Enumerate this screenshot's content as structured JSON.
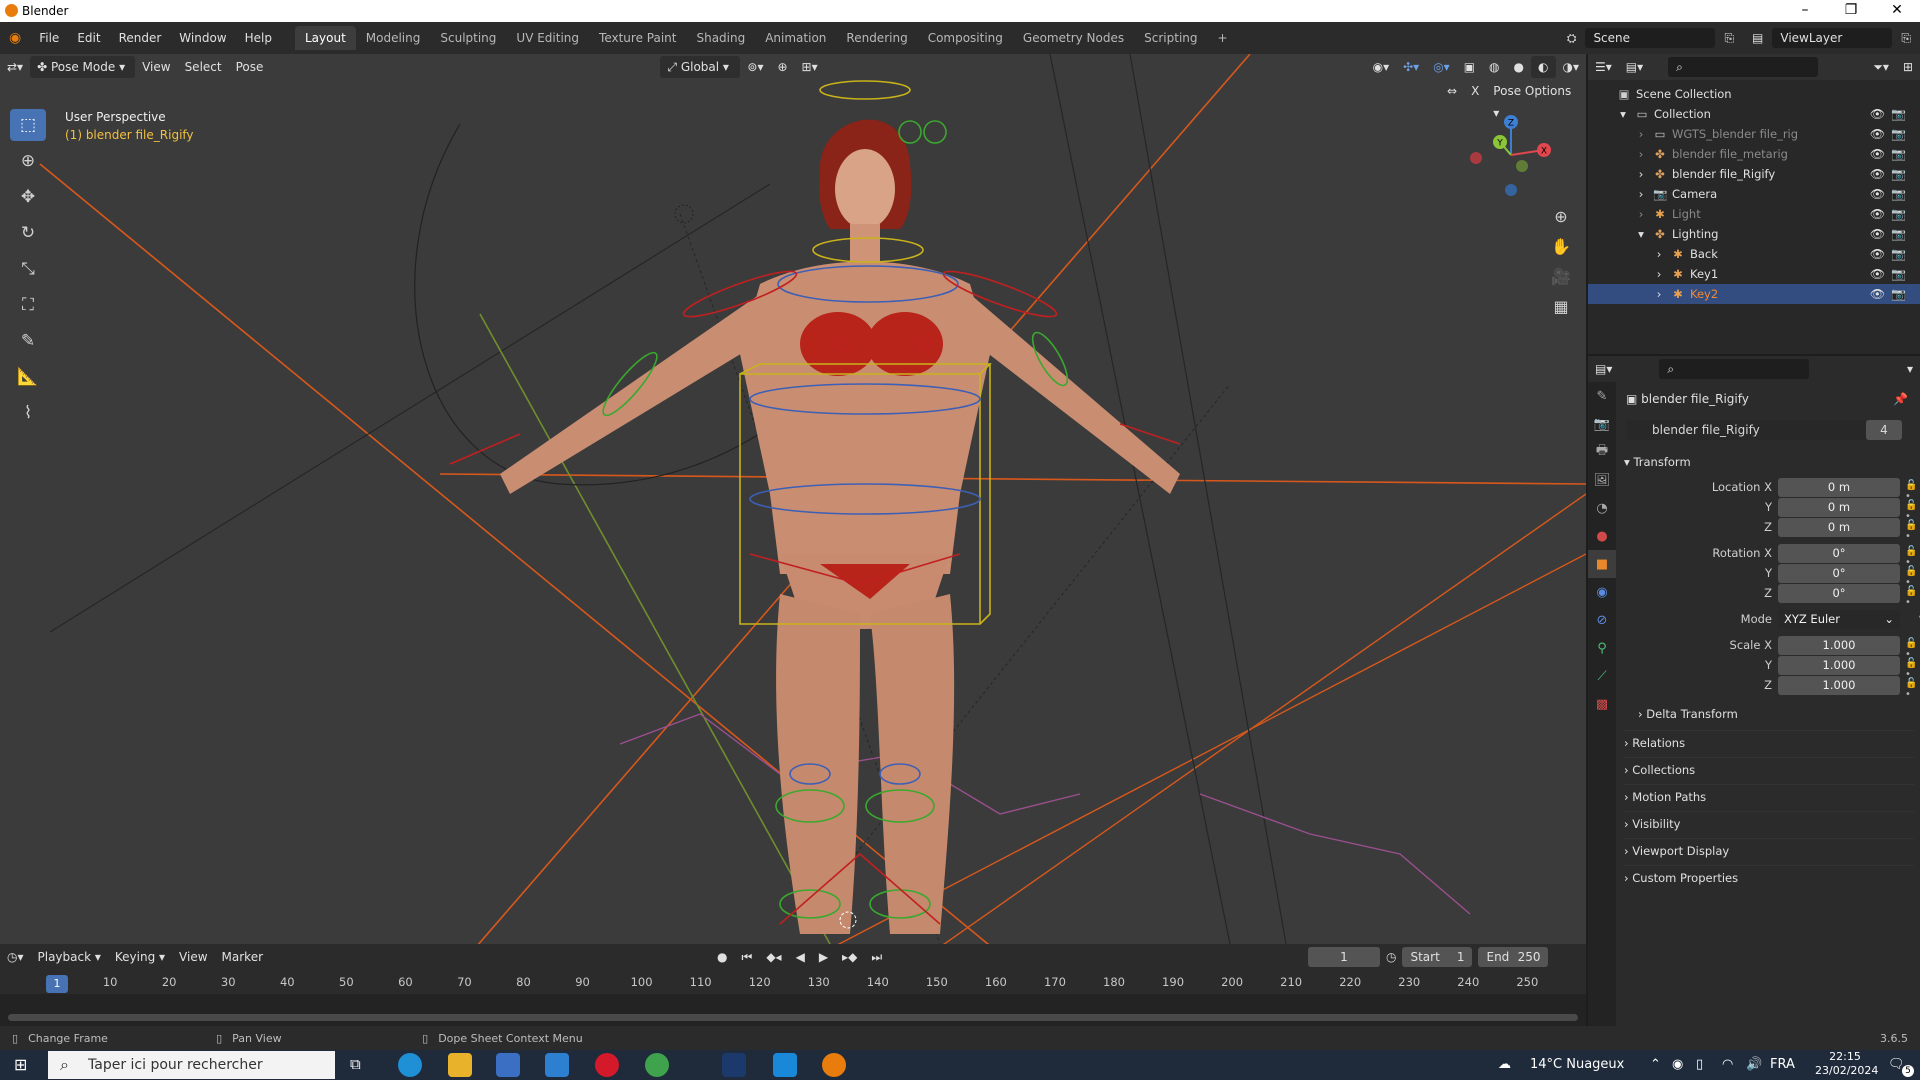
{
  "window": {
    "title": "Blender",
    "controls": [
      "–",
      "❐",
      "✕"
    ]
  },
  "menubar": {
    "menus": [
      "File",
      "Edit",
      "Render",
      "Window",
      "Help"
    ],
    "workspaces": [
      "Layout",
      "Modeling",
      "Sculpting",
      "UV Editing",
      "Texture Paint",
      "Shading",
      "Animation",
      "Rendering",
      "Compositing",
      "Geometry Nodes",
      "Scripting"
    ],
    "active_workspace": "Layout",
    "add_workspace": "+",
    "scene": "Scene",
    "view_layer": "ViewLayer"
  },
  "viewport": {
    "mode": "Pose Mode",
    "menus": [
      "View",
      "Select",
      "Pose"
    ],
    "transform_orientation": "Global",
    "pose_options": "Pose Options",
    "overlay_line1": "User Perspective",
    "overlay_line2": "(1) blender file_Rigify",
    "gizmo_axes": {
      "x": "X",
      "y": "Y",
      "z": "Z"
    },
    "axis_colors": {
      "x": "#e2474f",
      "y": "#8bc538",
      "z": "#3e7fd6"
    },
    "background_color": "#3b3b3b",
    "accent_color": "#4772b3"
  },
  "toolbar": {
    "tools": [
      "select-box-icon",
      "cursor-icon",
      "move-icon",
      "rotate-icon",
      "scale-icon",
      "transform-icon",
      "annotate-icon",
      "measure-icon",
      "relax-pose-icon"
    ]
  },
  "timeline": {
    "menus": [
      "Playback",
      "Keying",
      "View",
      "Marker"
    ],
    "current_frame": "1",
    "start_label": "Start",
    "start": "1",
    "end_label": "End",
    "end": "250",
    "ticks": [
      "10",
      "20",
      "30",
      "40",
      "50",
      "60",
      "70",
      "80",
      "90",
      "100",
      "110",
      "120",
      "130",
      "140",
      "150",
      "160",
      "170",
      "180",
      "190",
      "200",
      "210",
      "220",
      "230",
      "240",
      "250"
    ],
    "cursor_frame": "1"
  },
  "statusbar": {
    "hint1": "Change Frame",
    "hint2": "Pan View",
    "hint3": "Dope Sheet Context Menu",
    "version": "3.6.5"
  },
  "outliner": {
    "rows": [
      {
        "label": "Scene Collection",
        "icon": "scene-collection-icon",
        "indent": 0,
        "state": "normal"
      },
      {
        "label": "Collection",
        "icon": "collection-icon",
        "indent": 1,
        "state": "normal"
      },
      {
        "label": "WGTS_blender file_rig",
        "icon": "collection-icon",
        "indent": 2,
        "state": "dim"
      },
      {
        "label": "blender file_metarig",
        "icon": "armature-icon",
        "indent": 2,
        "state": "dim"
      },
      {
        "label": "blender file_Rigify",
        "icon": "armature-icon",
        "indent": 2,
        "state": "normal"
      },
      {
        "label": "Camera",
        "icon": "camera-icon",
        "indent": 2,
        "state": "normal"
      },
      {
        "label": "Light",
        "icon": "light-icon",
        "indent": 2,
        "state": "dim"
      },
      {
        "label": "Lighting",
        "icon": "armature-icon",
        "indent": 2,
        "state": "normal"
      },
      {
        "label": "Back",
        "icon": "light-icon",
        "indent": 3,
        "state": "normal"
      },
      {
        "label": "Key1",
        "icon": "light-icon",
        "indent": 3,
        "state": "normal"
      },
      {
        "label": "Key2",
        "icon": "light-icon",
        "indent": 3,
        "state": "selected"
      }
    ]
  },
  "properties": {
    "object_name": "blender file_Rigify",
    "datablock_name": "blender file_Rigify",
    "users": "4",
    "transform_header": "Transform",
    "location_label": "Location X",
    "location": [
      "0 m",
      "0 m",
      "0 m"
    ],
    "rotation_label": "Rotation X",
    "rotation": [
      "0°",
      "0°",
      "0°"
    ],
    "mode_label": "Mode",
    "mode_value": "XYZ Euler",
    "scale_label": "Scale X",
    "scale": [
      "1.000",
      "1.000",
      "1.000"
    ],
    "axis_y": "Y",
    "axis_z": "Z",
    "subpanels": [
      "Delta Transform",
      "Relations",
      "Collections",
      "Motion Paths",
      "Visibility",
      "Viewport Display",
      "Custom Properties"
    ]
  },
  "taskbar": {
    "search_placeholder": "Taper ici pour rechercher",
    "weather": "14°C  Nuageux",
    "language": "FRA",
    "time": "22:15",
    "date": "23/02/2024",
    "notifications": "5"
  }
}
